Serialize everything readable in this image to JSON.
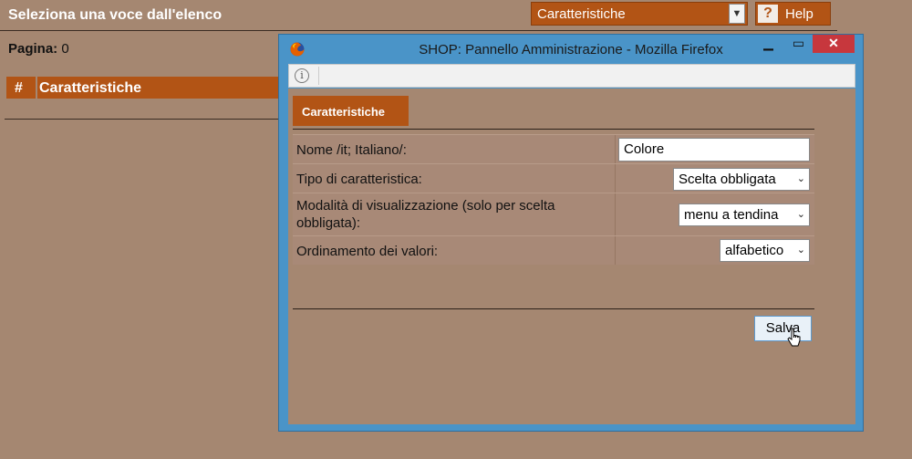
{
  "background": {
    "title": "Seleziona una voce dall'elenco",
    "section_select": "Caratteristiche",
    "help_label": "Help",
    "page_label": "Pagina:",
    "page_value": "0",
    "list_header_hash": "#",
    "list_header_label": "Caratteristiche"
  },
  "popup": {
    "window_title": "SHOP: Pannello Amministrazione - Mozilla Firefox",
    "tab_label": "Caratteristiche",
    "fields": {
      "name_label": "Nome /it; Italiano/:",
      "name_value": "Colore",
      "type_label": "Tipo di caratteristica:",
      "type_value": "Scelta obbligata",
      "display_label": "Modalità di visualizzazione (solo per scelta obbligata):",
      "display_value": "menu a tendina",
      "order_label": "Ordinamento dei valori:",
      "order_value": "alfabetico"
    },
    "save_label": "Salva"
  },
  "colors": {
    "background": "#a58771",
    "accent": "#b25415",
    "window_frame": "#4a94c8",
    "close_button": "#c7373d"
  }
}
